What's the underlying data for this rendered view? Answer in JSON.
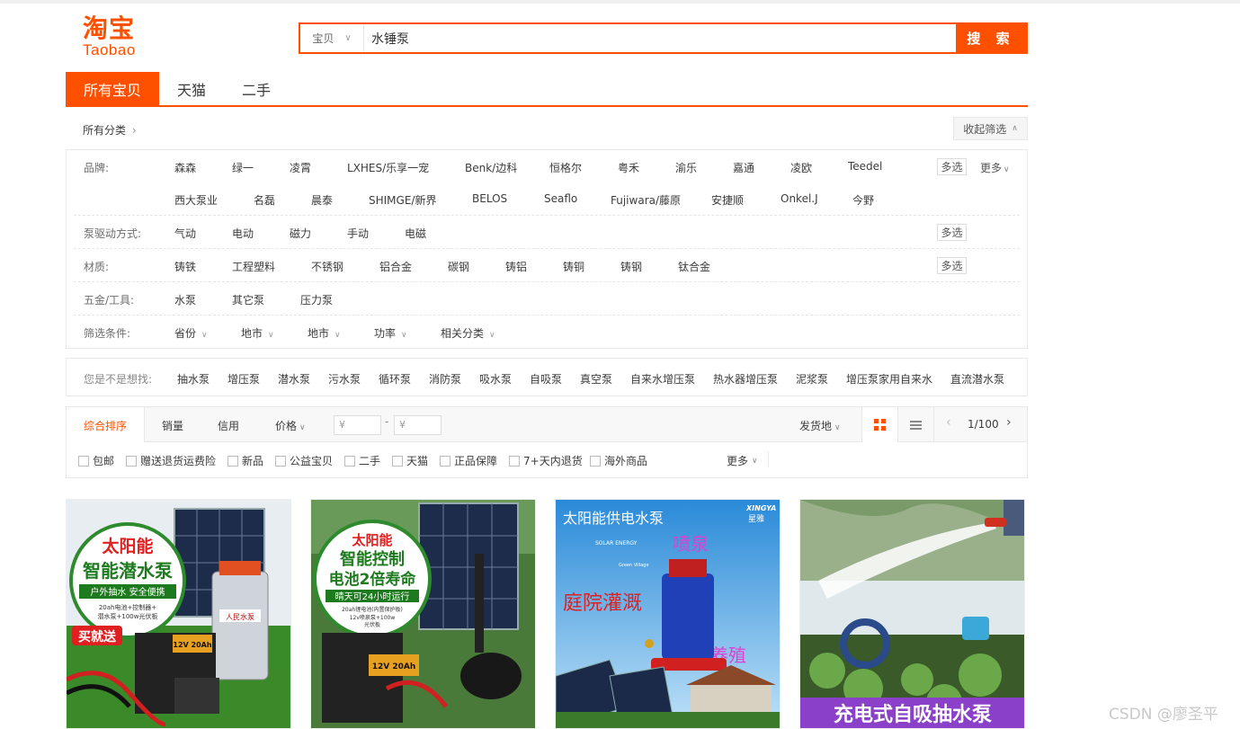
{
  "logo": {
    "cn": "淘宝",
    "en": "Taobao"
  },
  "search": {
    "category": "宝贝",
    "query": "水锤泵",
    "button": "搜 索"
  },
  "tabs": [
    "所有宝贝",
    "天猫",
    "二手"
  ],
  "all_categories": "所有分类",
  "collapse_filter": "收起筛选",
  "filters": {
    "brand": {
      "label": "品牌:",
      "items_row1": [
        "森森",
        "绿一",
        "凌霄",
        "LXHES/乐享一宠",
        "Benk/边科",
        "恒格尔",
        "粤禾",
        "渝乐",
        "嘉通",
        "凌欧",
        "Teedel"
      ],
      "items_row2": [
        "西大泵业",
        "名磊",
        "晨泰",
        "SHIMGE/新界",
        "BELOS",
        "Seaflo",
        "Fujiwara/藤原",
        "安捷顺",
        "Onkel.J",
        "今野"
      ],
      "multi": "多选",
      "more": "更多"
    },
    "drive": {
      "label": "泵驱动方式:",
      "items": [
        "气动",
        "电动",
        "磁力",
        "手动",
        "电磁"
      ],
      "multi": "多选"
    },
    "material": {
      "label": "材质:",
      "items": [
        "铸铁",
        "工程塑料",
        "不锈钢",
        "铝合金",
        "碳钢",
        "铸铝",
        "铸铜",
        "铸钢",
        "钛合金"
      ],
      "multi": "多选"
    },
    "hardware": {
      "label": "五金/工具:",
      "items": [
        "水泵",
        "其它泵",
        "压力泵"
      ]
    },
    "conditions": {
      "label": "筛选条件:",
      "items": [
        "省份",
        "地市",
        "地市",
        "功率",
        "相关分类"
      ]
    }
  },
  "suggest": {
    "label": "您是不是想找:",
    "items": [
      "抽水泵",
      "增压泵",
      "潜水泵",
      "污水泵",
      "循环泵",
      "消防泵",
      "吸水泵",
      "自吸泵",
      "真空泵",
      "自来水增压泵",
      "热水器增压泵",
      "泥浆泵",
      "增压泵家用自来水",
      "直流潜水泵"
    ]
  },
  "sort": {
    "items": [
      "综合排序",
      "销量",
      "信用",
      "价格"
    ],
    "price_min_placeholder": "¥",
    "price_max_placeholder": "¥",
    "price_dash": "-",
    "ship_from": "发货地",
    "page": "1/100"
  },
  "checks": [
    "包邮",
    "赠送退货运费险",
    "新品",
    "公益宝贝",
    "二手",
    "天猫",
    "正品保障",
    "7+天内退货",
    "海外商品"
  ],
  "checks_more": "更多",
  "products": [
    {
      "texts": [
        "太阳能",
        "智能潜水泵",
        "户外抽水 安全便携",
        "20ah电池+控制器+",
        "潜水泵+100w光伏板",
        "买就送",
        "12V 20Ah",
        "人民水泵"
      ]
    },
    {
      "texts": [
        "太阳能",
        "智能控制",
        "电池2倍寿命",
        "晴天可24小时运行",
        "20ah锂电池(内置保护板)",
        "12v喷泉泵+100w",
        "光伏板",
        "12V 20Ah"
      ]
    },
    {
      "texts": [
        "太阳能供电水泵",
        "XINGYA",
        "星雅",
        "SOLAR ENERGY",
        "Green Village",
        "喷泉",
        "庭院灌溉",
        "养殖"
      ]
    },
    {
      "texts": [
        "充电式自吸抽水泵"
      ]
    }
  ],
  "watermark": "CSDN @廖圣平",
  "colors": {
    "accent": "#ff5000"
  }
}
